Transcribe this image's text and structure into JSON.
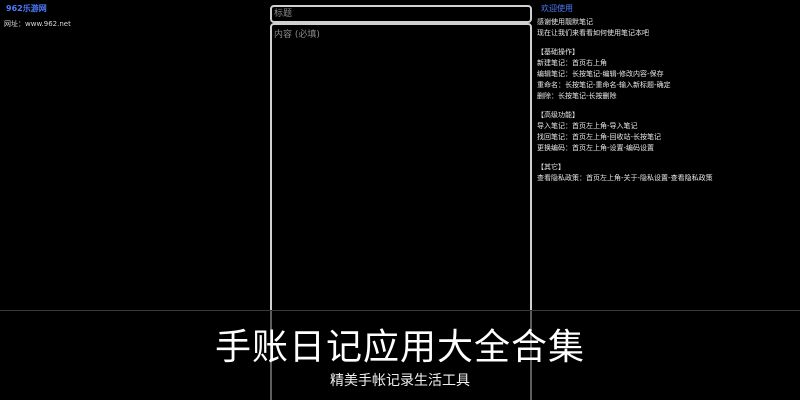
{
  "site": {
    "name": "962乐游网",
    "url": "网址：www.962.net"
  },
  "editor": {
    "title_placeholder": "标题",
    "content_placeholder": "内容 (必填)"
  },
  "help": {
    "title": "欢迎使用",
    "intro": [
      "感谢使用靓默笔记",
      "现在让我们来看看如何使用笔记本吧"
    ],
    "basic_heading": "【基础操作】",
    "basic": [
      "新建笔记：首页右上角",
      "编辑笔记：长按笔记-编辑-修改内容-保存",
      "重命名：长按笔记-重命名-输入新标题-确定",
      "删除：长按笔记-长按删除"
    ],
    "advanced_heading": "【高级功能】",
    "advanced": [
      "导入笔记：首页左上角-导入笔记",
      "找回笔记：首页左上角-回收站-长按笔记",
      "更换编码：首页左上角-设置-编码设置"
    ],
    "other_heading": "【其它】",
    "other": [
      "查看隐私政策：首页左上角-关于-隐私设置-查看隐私政策"
    ]
  },
  "banner": {
    "title": "手账日记应用大全合集",
    "subtitle": "精美手帐记录生活工具"
  }
}
